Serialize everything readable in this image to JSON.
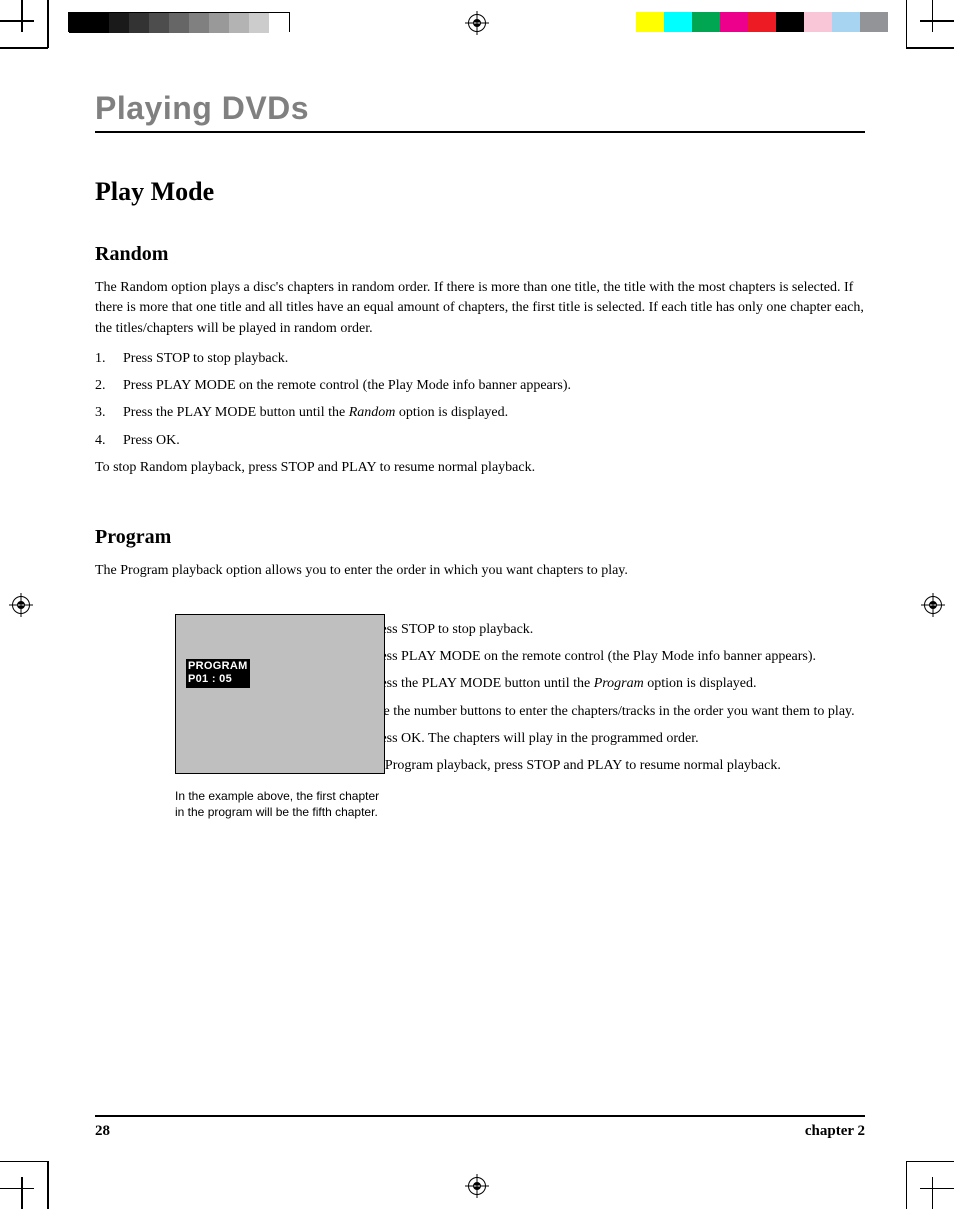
{
  "header": {
    "chapter_title": "Playing DVDs"
  },
  "section": {
    "title": "Play Mode"
  },
  "random": {
    "heading": "Random",
    "intro": "The Random option plays a disc's chapters in random order. If there is more than one title, the title with the most chapters is selected. If there is more that one title and all titles have an equal amount of chapters, the first title is selected. If each title has only one chapter each, the titles/chapters will be played in random order.",
    "steps": [
      "Press STOP to stop playback.",
      "Press PLAY MODE on the remote control (the Play Mode info banner appears).",
      {
        "pre": "Press the PLAY MODE button until the ",
        "em": "Random",
        "post": " option is displayed."
      },
      "Press OK."
    ],
    "outro": "To stop Random playback, press STOP and PLAY to resume normal playback."
  },
  "program": {
    "heading": "Program",
    "intro": "The Program playback option allows you to enter the order in which you want chapters to play.",
    "screenshot": {
      "line1": "PROGRAM",
      "line2": "P01 : 05"
    },
    "caption": "In the example above, the first chapter in the program will be the fifth chapter.",
    "steps": [
      "Press STOP to stop playback.",
      "Press PLAY MODE on the remote control (the Play Mode info banner appears).",
      {
        "pre": "Press the PLAY MODE button until the ",
        "em": "Program",
        "post": " option is displayed."
      },
      "Use the number buttons to enter the chapters/tracks in the order you want them to play.",
      "Press OK. The chapters will play in the programmed order."
    ],
    "outro": "To stop Program playback, press STOP and PLAY to resume normal playback."
  },
  "footer": {
    "page": "28",
    "chapter": "chapter 2"
  },
  "print": {
    "gray_swatches": [
      "#000",
      "#000",
      "#1a1a1a",
      "#333",
      "#4d4d4d",
      "#666",
      "#808080",
      "#999",
      "#b3b3b3",
      "#ccc",
      "#fff"
    ],
    "color_swatches": [
      "#ffff00",
      "#00ffff",
      "#00a651",
      "#ec008c",
      "#ed1c24",
      "#000000",
      "#f9c6d8",
      "#a7d5f1",
      "#929497"
    ]
  }
}
